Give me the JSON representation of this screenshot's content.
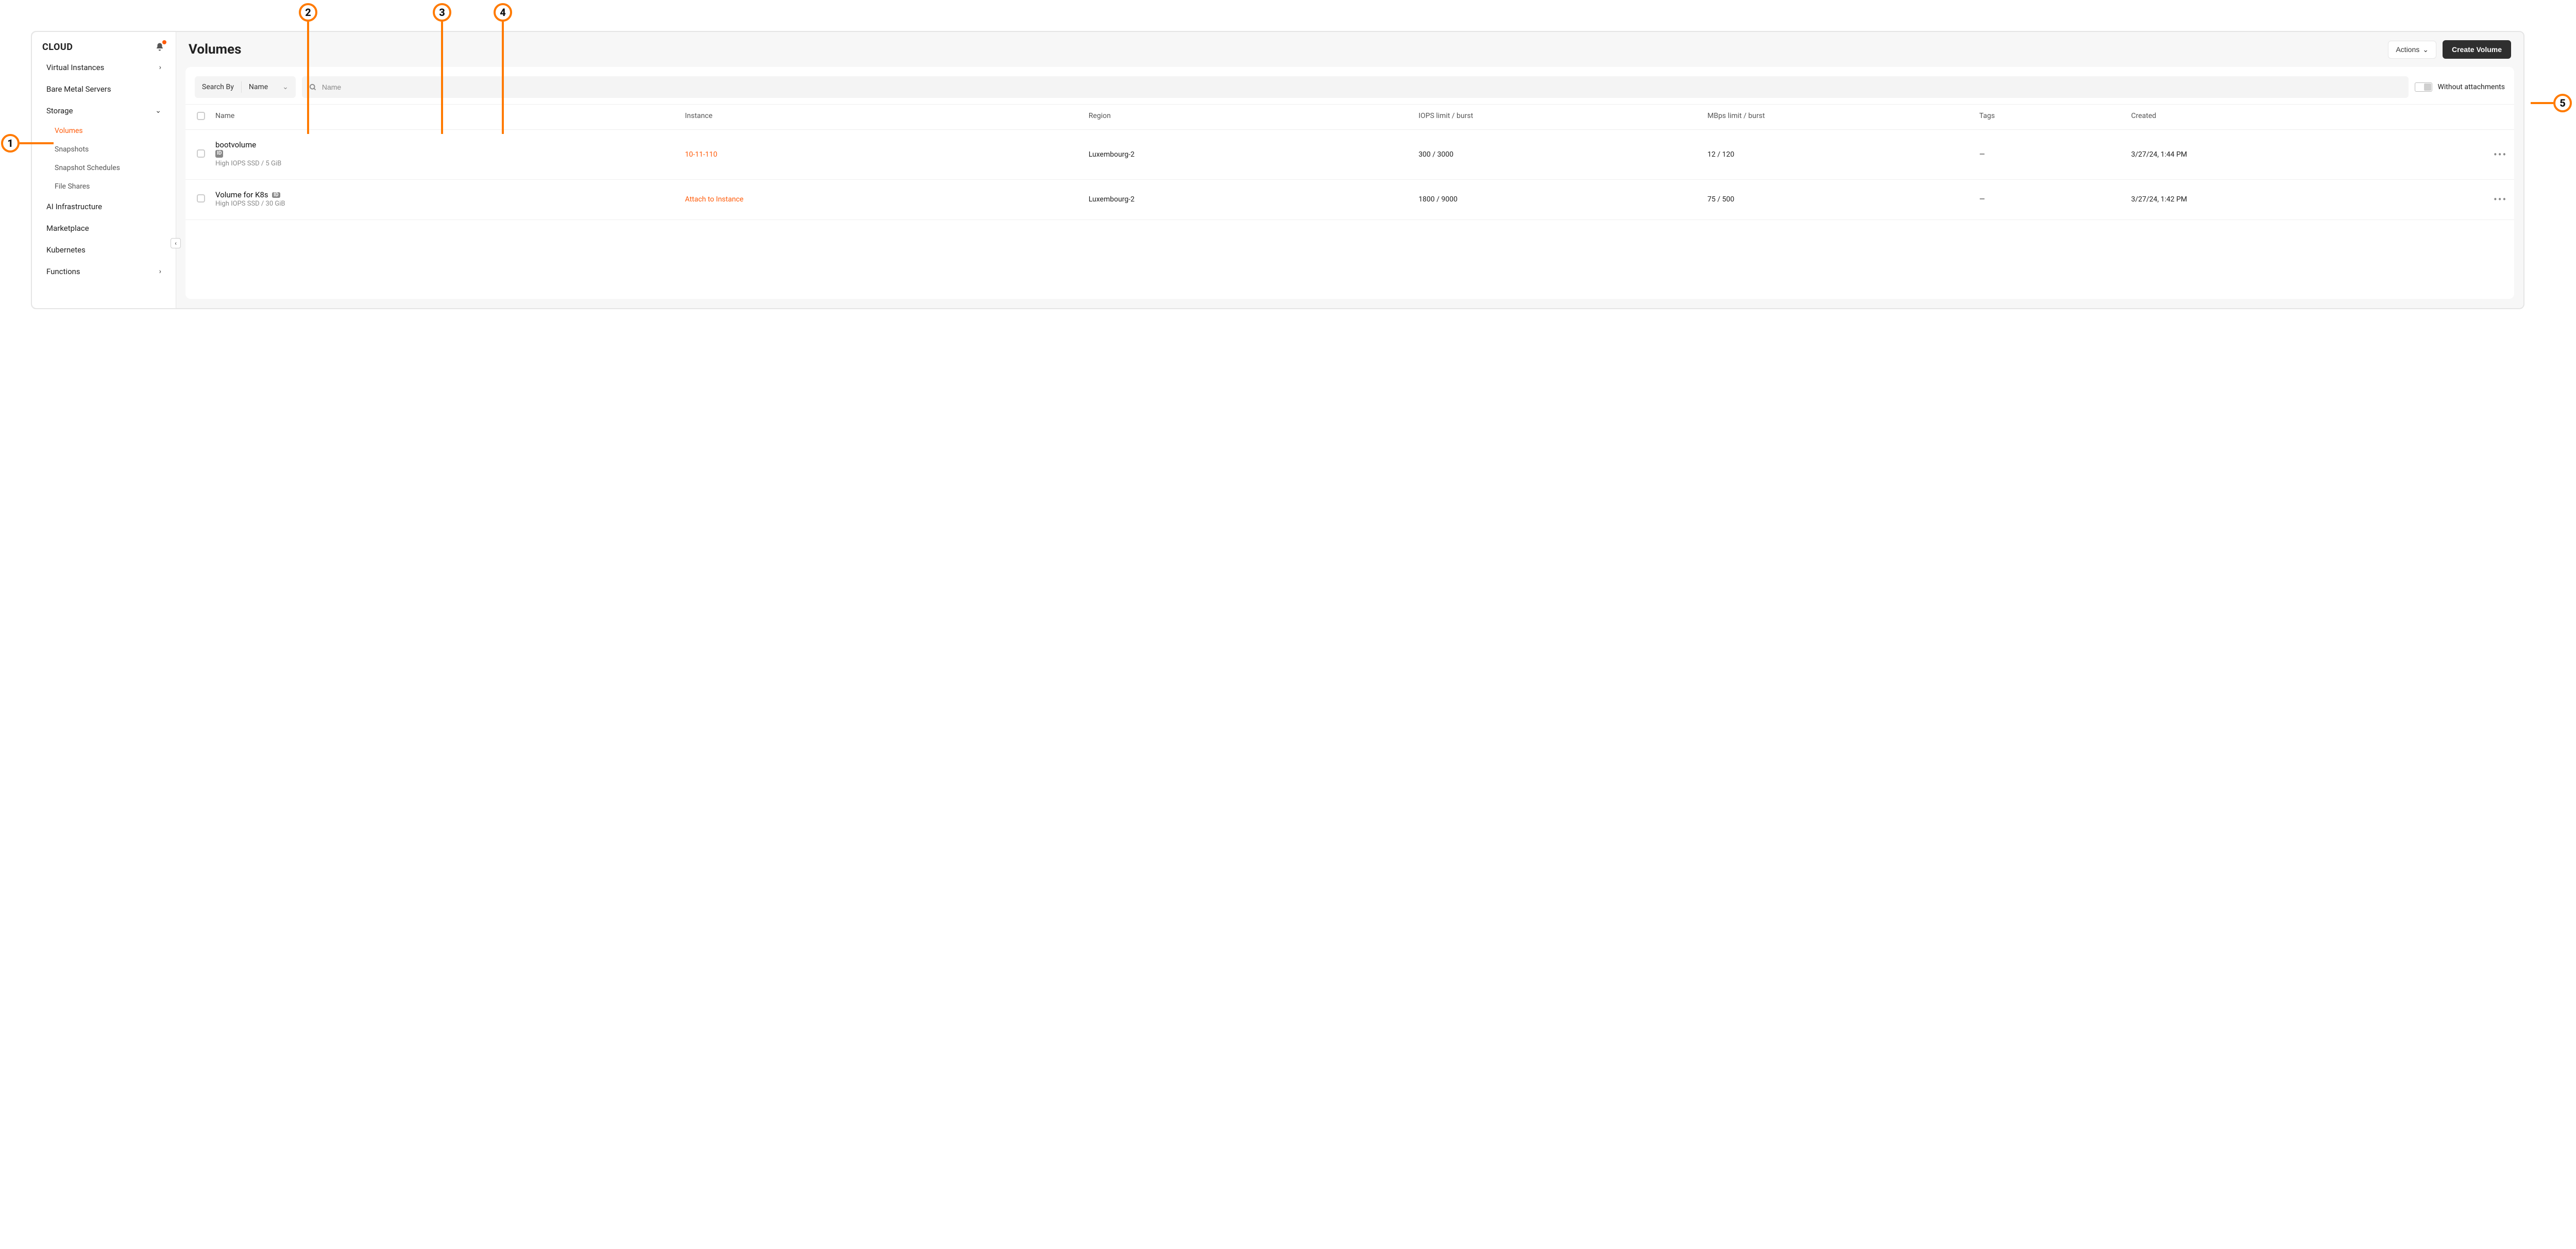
{
  "colors": {
    "accent": "#ff5b0a"
  },
  "sidebar": {
    "title": "CLOUD",
    "items": {
      "virtual_instances": "Virtual Instances",
      "bare_metal": "Bare Metal Servers",
      "storage": "Storage",
      "ai_infra": "AI Infrastructure",
      "marketplace": "Marketplace",
      "kubernetes": "Kubernetes",
      "functions": "Functions"
    },
    "storage_children": {
      "volumes": "Volumes",
      "snapshots": "Snapshots",
      "schedules": "Snapshot Schedules",
      "file_shares": "File Shares"
    }
  },
  "header": {
    "title": "Volumes",
    "actions_label": "Actions",
    "create_label": "Create Volume"
  },
  "filter": {
    "search_by_label": "Search By",
    "search_field_label": "Name",
    "search_placeholder": "Name",
    "without_attachments_label": "Without attachments"
  },
  "table": {
    "columns": {
      "name": "Name",
      "instance": "Instance",
      "region": "Region",
      "iops": "IOPS limit / burst",
      "mbps": "MBps limit / burst",
      "tags": "Tags",
      "created": "Created"
    },
    "rows": [
      {
        "name": "bootvolume",
        "sub": "High IOPS SSD / 5 GiB",
        "instance": "10-11-110",
        "instance_is_link": true,
        "region": "Luxembourg-2",
        "iops": "300 / 3000",
        "mbps": "12 / 120",
        "tags": "—",
        "created": "3/27/24, 1:44 PM"
      },
      {
        "name": "Volume for K8s",
        "sub": "High IOPS SSD / 30 GiB",
        "instance": "Attach to Instance",
        "instance_is_link": true,
        "region": "Luxembourg-2",
        "iops": "1800 / 9000",
        "mbps": "75 / 500",
        "tags": "—",
        "created": "3/27/24, 1:42 PM"
      }
    ]
  },
  "callouts": {
    "c1": "1",
    "c2": "2",
    "c3": "3",
    "c4": "4",
    "c5": "5"
  }
}
